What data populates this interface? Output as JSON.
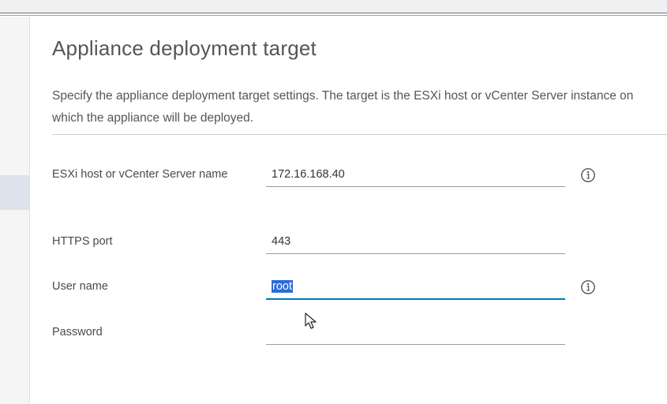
{
  "page": {
    "title": "Appliance deployment target",
    "description": "Specify the appliance deployment target settings. The target is the ESXi host or vCenter Server instance on which the appliance will be deployed."
  },
  "form": {
    "host": {
      "label": "ESXi host or vCenter Server name",
      "value": "172.16.168.40",
      "info_icon": "info-icon"
    },
    "https_port": {
      "label": "HTTPS port",
      "value": "443"
    },
    "username": {
      "label": "User name",
      "value": "root",
      "info_icon": "info-icon"
    },
    "password": {
      "label": "Password",
      "value": ""
    }
  },
  "colors": {
    "accent": "#0079b8",
    "selection": "#2f6bd8"
  }
}
